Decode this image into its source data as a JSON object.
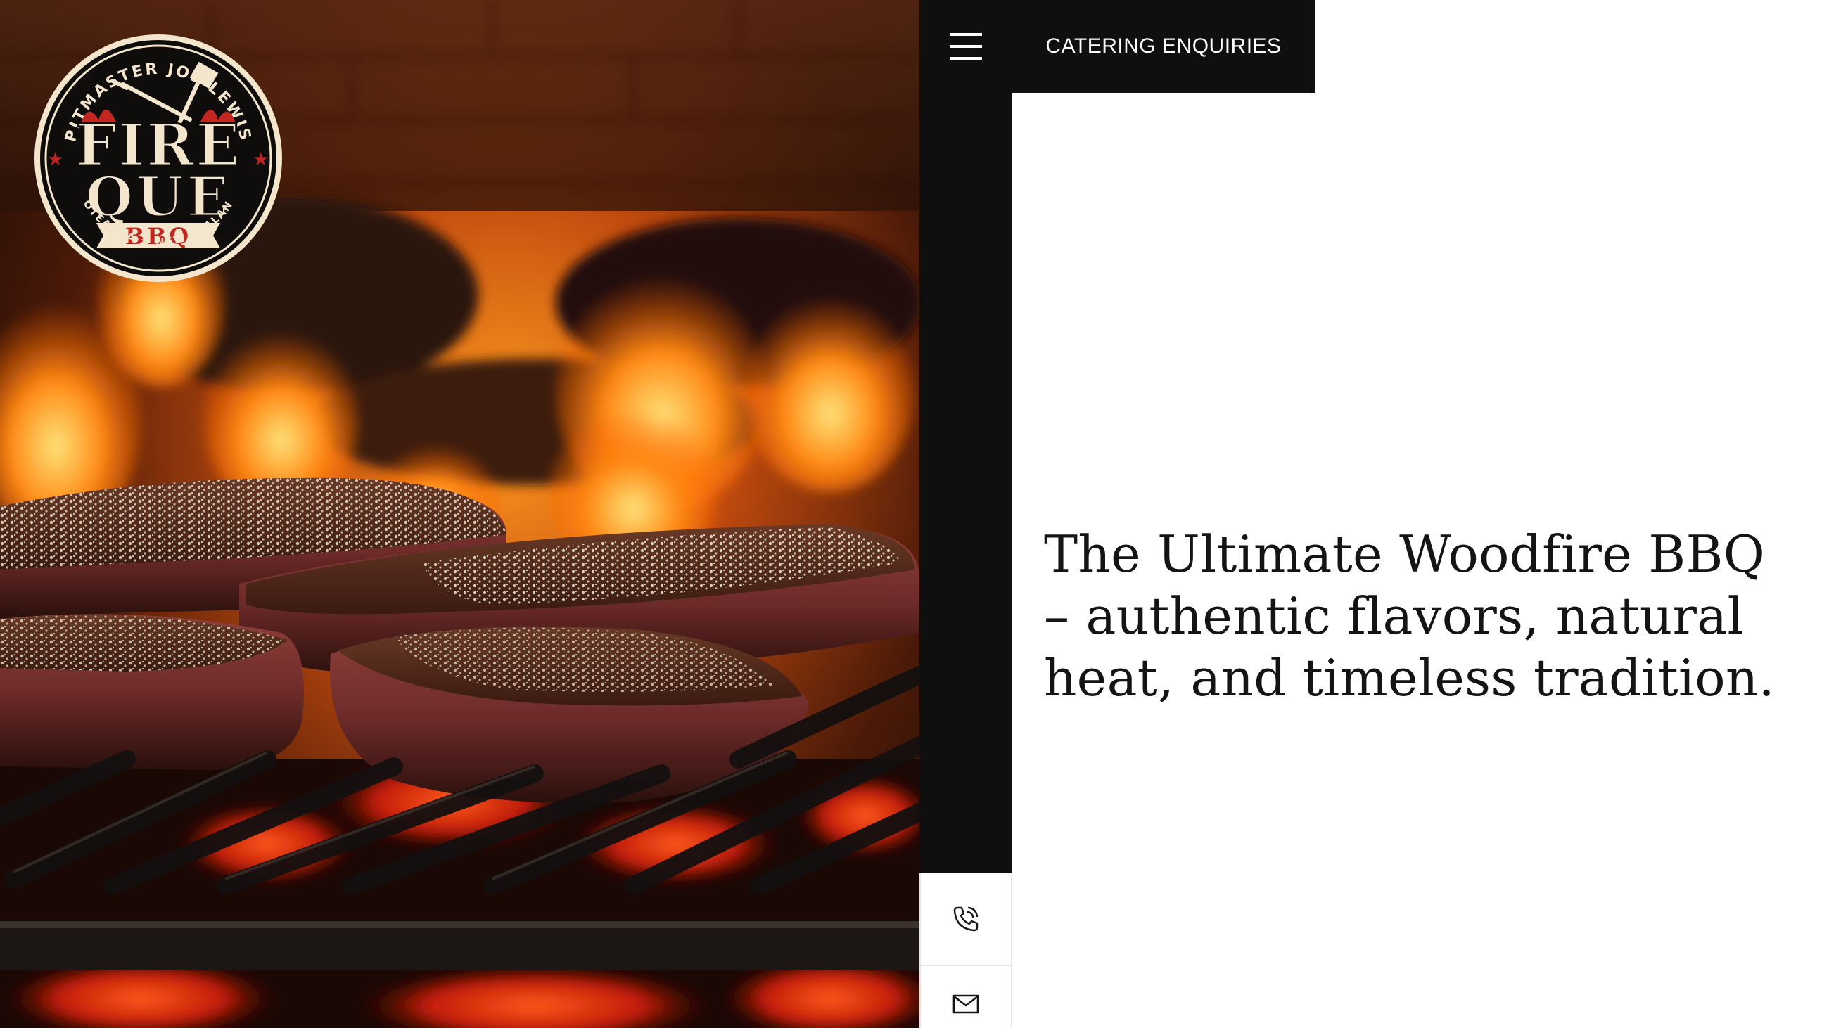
{
  "logo": {
    "arc_text": "PITMASTER JOE LEWIS",
    "line1": "FIRE",
    "line2": "QUE",
    "ribbon": "BBQ",
    "bottom_text": "AOTEAROA ★ NEW ZEALAND",
    "icon": "grill-tools-icon"
  },
  "nav": {
    "menu_icon": "hamburger-menu-icon",
    "catering_label": "CATERING ENQUIRIES"
  },
  "contact": {
    "phone_icon": "phone-icon",
    "email_icon": "mail-icon"
  },
  "hero": {
    "headline": "The Ultimate Woodfire BBQ – authentic flavors, natural heat, and timeless tradition."
  },
  "colors": {
    "dark": "#0f0f10",
    "white": "#ffffff",
    "logo_red": "#c2261f",
    "logo_cream": "#f3e6cc"
  }
}
